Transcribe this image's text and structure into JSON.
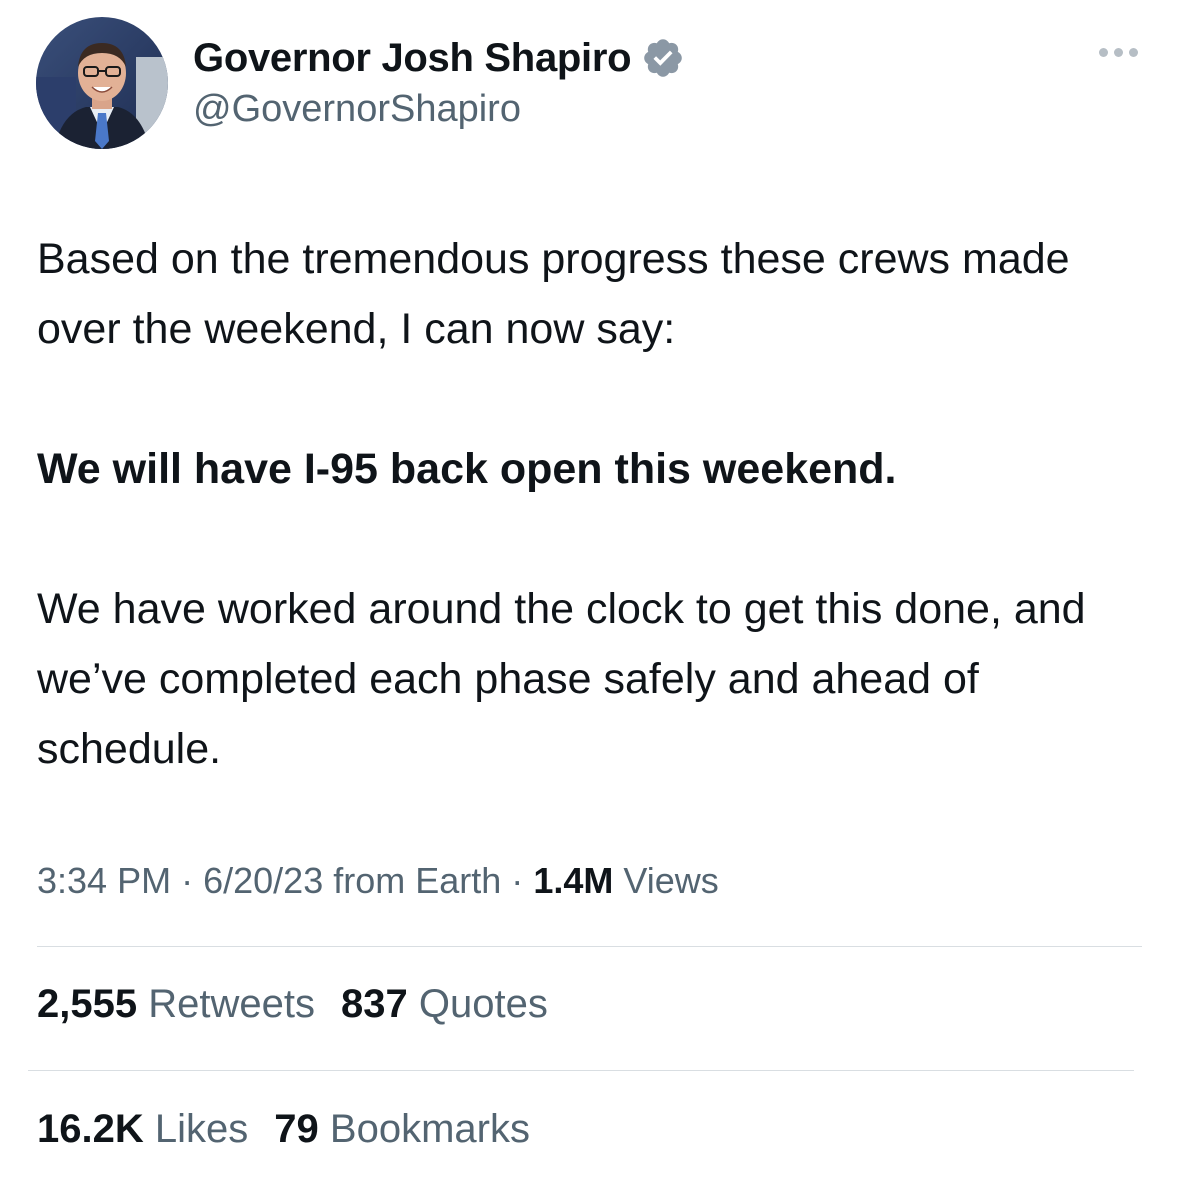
{
  "author": {
    "display_name": "Governor Josh Shapiro",
    "handle": "@GovernorShapiro",
    "verified": true,
    "verified_color": "#1d9bf0"
  },
  "tweet": {
    "paragraph1": "Based on the tremendous progress these crews made over the weekend, I can now say:",
    "paragraph2": "We will have I-95 back open this weekend.",
    "paragraph3": "We have worked around the clock to get this done, and we’ve completed each phase safely and ahead of schedule."
  },
  "meta": {
    "time": "3:34 PM",
    "separator": "·",
    "date_source": "6/20/23 from Earth",
    "views_count": "1.4M",
    "views_label": "Views"
  },
  "stats": {
    "retweets_count": "2,555",
    "retweets_label": "Retweets",
    "quotes_count": "837",
    "quotes_label": "Quotes",
    "likes_count": "16.2K",
    "likes_label": "Likes",
    "bookmarks_count": "79",
    "bookmarks_label": "Bookmarks"
  },
  "icons": {
    "more": "more-options-icon",
    "verified": "verified-badge-icon"
  }
}
